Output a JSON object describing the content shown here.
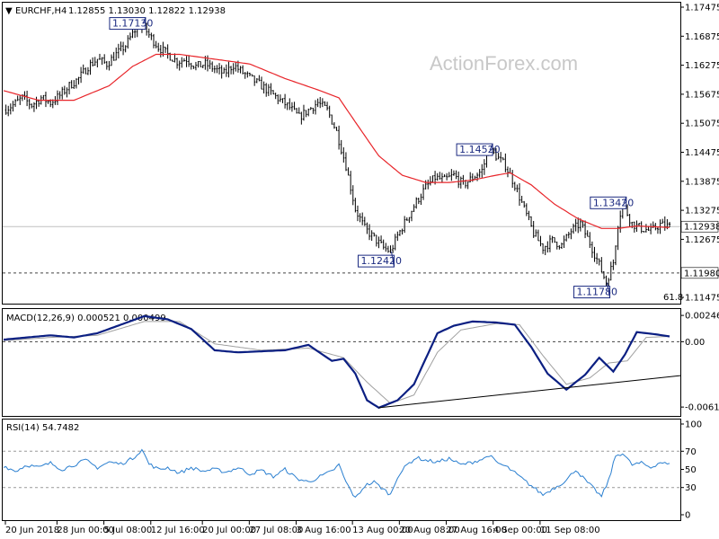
{
  "header": {
    "arrow": "▼",
    "symbol_text": "EURCHF,H4",
    "ohlc_text": "1.12855 1.13030 1.12822 1.12938"
  },
  "watermark": "ActionForex.com",
  "colors": {
    "candle": "#000000",
    "ma": "#e8252a",
    "macd": "#0b1f82",
    "signal": "#a0a0a0",
    "rsi": "#2a7fd0",
    "grid": "#c0c0c0",
    "dashed": "#888888"
  },
  "chart_data": [
    {
      "type": "candlestick",
      "panel": "price",
      "ylim": [
        1.11475,
        1.17475
      ],
      "y_ticks": [
        "1.17475",
        "1.16875",
        "1.16275",
        "1.15675",
        "1.15075",
        "1.14475",
        "1.13875",
        "1.13275",
        "1.12675",
        "1.11980",
        "1.11475"
      ],
      "y_tick_values": [
        1.17475,
        1.16875,
        1.16275,
        1.15675,
        1.15075,
        1.14475,
        1.13875,
        1.13275,
        1.12675,
        1.1198,
        1.11475
      ],
      "current_price_label": "1.12938",
      "current_price": 1.12938,
      "support_label": "1.11980",
      "support": 1.1198,
      "fib_label": "61.8",
      "annotations": [
        {
          "text": "1.17130",
          "value": 1.1713
        },
        {
          "text": "1.12420",
          "value": 1.1242
        },
        {
          "text": "1.14520",
          "value": 1.1452
        },
        {
          "text": "1.11780",
          "value": 1.1178
        },
        {
          "text": "1.13420",
          "value": 1.1342
        }
      ],
      "close_path": [
        [
          0,
          1.1535
        ],
        [
          4,
          1.1545
        ],
        [
          8,
          1.156
        ],
        [
          12,
          1.1545
        ],
        [
          16,
          1.156
        ],
        [
          20,
          1.155
        ],
        [
          24,
          1.1565
        ],
        [
          28,
          1.1585
        ],
        [
          32,
          1.16
        ],
        [
          36,
          1.1625
        ],
        [
          40,
          1.164
        ],
        [
          44,
          1.163
        ],
        [
          48,
          1.165
        ],
        [
          52,
          1.1668
        ],
        [
          56,
          1.17
        ],
        [
          59,
          1.1713
        ],
        [
          62,
          1.169
        ],
        [
          66,
          1.1665
        ],
        [
          70,
          1.165
        ],
        [
          74,
          1.1635
        ],
        [
          78,
          1.164
        ],
        [
          82,
          1.1625
        ],
        [
          86,
          1.163
        ],
        [
          90,
          1.162
        ],
        [
          94,
          1.161
        ],
        [
          98,
          1.1628
        ],
        [
          102,
          1.1612
        ],
        [
          106,
          1.1598
        ],
        [
          110,
          1.1585
        ],
        [
          114,
          1.157
        ],
        [
          118,
          1.1555
        ],
        [
          122,
          1.154
        ],
        [
          126,
          1.152
        ],
        [
          130,
          1.1535
        ],
        [
          134,
          1.155
        ],
        [
          138,
          1.1535
        ],
        [
          142,
          1.149
        ],
        [
          146,
          1.142
        ],
        [
          150,
          1.133
        ],
        [
          154,
          1.129
        ],
        [
          158,
          1.127
        ],
        [
          162,
          1.125
        ],
        [
          165,
          1.1242
        ],
        [
          168,
          1.1275
        ],
        [
          172,
          1.131
        ],
        [
          176,
          1.1345
        ],
        [
          180,
          1.1375
        ],
        [
          184,
          1.1395
        ],
        [
          188,
          1.139
        ],
        [
          192,
          1.14
        ],
        [
          196,
          1.138
        ],
        [
          200,
          1.1395
        ],
        [
          204,
          1.141
        ],
        [
          207,
          1.1452
        ],
        [
          210,
          1.144
        ],
        [
          214,
          1.142
        ],
        [
          218,
          1.138
        ],
        [
          222,
          1.133
        ],
        [
          226,
          1.128
        ],
        [
          230,
          1.125
        ],
        [
          234,
          1.1265
        ],
        [
          238,
          1.1255
        ],
        [
          242,
          1.1285
        ],
        [
          246,
          1.13
        ],
        [
          250,
          1.126
        ],
        [
          254,
          1.1215
        ],
        [
          257,
          1.1178
        ],
        [
          260,
          1.122
        ],
        [
          262,
          1.13
        ],
        [
          264,
          1.1342
        ],
        [
          268,
          1.13
        ],
        [
          272,
          1.129
        ],
        [
          276,
          1.1285
        ],
        [
          280,
          1.1298
        ],
        [
          284,
          1.1294
        ]
      ],
      "ma_path": [
        [
          0,
          1.1575
        ],
        [
          15,
          1.1555
        ],
        [
          30,
          1.1555
        ],
        [
          45,
          1.1585
        ],
        [
          55,
          1.1625
        ],
        [
          65,
          1.165
        ],
        [
          75,
          1.165
        ],
        [
          90,
          1.164
        ],
        [
          105,
          1.163
        ],
        [
          120,
          1.16
        ],
        [
          135,
          1.1575
        ],
        [
          143,
          1.156
        ],
        [
          150,
          1.151
        ],
        [
          160,
          1.144
        ],
        [
          170,
          1.14
        ],
        [
          180,
          1.1385
        ],
        [
          190,
          1.1385
        ],
        [
          200,
          1.139
        ],
        [
          210,
          1.14
        ],
        [
          216,
          1.1405
        ],
        [
          225,
          1.138
        ],
        [
          235,
          1.134
        ],
        [
          245,
          1.131
        ],
        [
          255,
          1.129
        ],
        [
          262,
          1.129
        ],
        [
          270,
          1.1295
        ],
        [
          284,
          1.1292
        ]
      ]
    },
    {
      "type": "line",
      "panel": "macd",
      "title": "MACD(12,26,9) 0.000521 0.000499",
      "ylim": [
        -0.0068,
        0.0029
      ],
      "y_ticks": [
        "0.002469",
        "0.00",
        "-0.006136"
      ],
      "y_tick_values": [
        0.002469,
        0.0,
        -0.006136
      ],
      "series": [
        {
          "values": [
            [
              0,
              0.0002
            ],
            [
              10,
              0.0004
            ],
            [
              20,
              0.0006
            ],
            [
              30,
              0.0004
            ],
            [
              40,
              0.0008
            ],
            [
              50,
              0.0016
            ],
            [
              60,
              0.0024
            ],
            [
              70,
              0.0021
            ],
            [
              80,
              0.0012
            ],
            [
              90,
              -0.0008
            ],
            [
              100,
              -0.001
            ],
            [
              110,
              -0.0009
            ],
            [
              120,
              -0.0008
            ],
            [
              130,
              -0.0003
            ],
            [
              140,
              -0.0018
            ],
            [
              145,
              -0.0016
            ],
            [
              150,
              -0.003
            ],
            [
              155,
              -0.0055
            ],
            [
              160,
              -0.0062
            ],
            [
              168,
              -0.0055
            ],
            [
              175,
              -0.004
            ],
            [
              185,
              0.0008
            ],
            [
              192,
              0.0015
            ],
            [
              200,
              0.0019
            ],
            [
              210,
              0.0018
            ],
            [
              218,
              0.0016
            ],
            [
              225,
              -0.0005
            ],
            [
              232,
              -0.003
            ],
            [
              240,
              -0.0045
            ],
            [
              248,
              -0.0031
            ],
            [
              254,
              -0.0015
            ],
            [
              260,
              -0.0028
            ],
            [
              265,
              -0.0012
            ],
            [
              270,
              0.0009
            ],
            [
              278,
              0.0007
            ],
            [
              284,
              0.0005
            ]
          ]
        },
        {
          "values": [
            [
              0,
              0.0001
            ],
            [
              20,
              0.0004
            ],
            [
              40,
              0.0006
            ],
            [
              60,
              0.0019
            ],
            [
              75,
              0.0019
            ],
            [
              90,
              -0.0002
            ],
            [
              110,
              -0.0008
            ],
            [
              130,
              -0.0006
            ],
            [
              145,
              -0.0015
            ],
            [
              155,
              -0.0038
            ],
            [
              165,
              -0.0058
            ],
            [
              175,
              -0.005
            ],
            [
              185,
              -0.001
            ],
            [
              195,
              0.0011
            ],
            [
              210,
              0.0017
            ],
            [
              220,
              0.0016
            ],
            [
              230,
              -0.0013
            ],
            [
              240,
              -0.004
            ],
            [
              250,
              -0.0034
            ],
            [
              258,
              -0.002
            ],
            [
              266,
              -0.0018
            ],
            [
              274,
              0.0004
            ],
            [
              284,
              0.0005
            ]
          ]
        }
      ],
      "trendline": [
        [
          160,
          -0.0062
        ],
        [
          284,
          -0.0033
        ]
      ]
    },
    {
      "type": "line",
      "panel": "rsi",
      "title": "RSI(14) 54.7482",
      "ylim": [
        0,
        100
      ],
      "y_ticks": [
        "100",
        "70",
        "50",
        "30",
        "0"
      ],
      "y_tick_values": [
        100,
        70,
        50,
        30,
        0
      ],
      "levels": [
        70,
        30
      ],
      "series": [
        {
          "values": [
            [
              0,
              54
            ],
            [
              5,
              48
            ],
            [
              10,
              55
            ],
            [
              15,
              52
            ],
            [
              20,
              57
            ],
            [
              25,
              50
            ],
            [
              30,
              55
            ],
            [
              35,
              60
            ],
            [
              40,
              52
            ],
            [
              45,
              58
            ],
            [
              50,
              56
            ],
            [
              55,
              62
            ],
            [
              59,
              72
            ],
            [
              62,
              56
            ],
            [
              66,
              50
            ],
            [
              70,
              52
            ],
            [
              75,
              46
            ],
            [
              80,
              52
            ],
            [
              85,
              48
            ],
            [
              90,
              50
            ],
            [
              95,
              47
            ],
            [
              100,
              52
            ],
            [
              105,
              45
            ],
            [
              110,
              49
            ],
            [
              115,
              42
            ],
            [
              120,
              50
            ],
            [
              125,
              40
            ],
            [
              130,
              36
            ],
            [
              135,
              42
            ],
            [
              140,
              48
            ],
            [
              143,
              55
            ],
            [
              146,
              36
            ],
            [
              150,
              18
            ],
            [
              154,
              32
            ],
            [
              158,
              36
            ],
            [
              162,
              28
            ],
            [
              165,
              22
            ],
            [
              168,
              42
            ],
            [
              172,
              55
            ],
            [
              176,
              63
            ],
            [
              180,
              60
            ],
            [
              185,
              58
            ],
            [
              190,
              62
            ],
            [
              195,
              55
            ],
            [
              200,
              58
            ],
            [
              205,
              62
            ],
            [
              207,
              66
            ],
            [
              210,
              58
            ],
            [
              215,
              52
            ],
            [
              220,
              42
            ],
            [
              225,
              32
            ],
            [
              230,
              22
            ],
            [
              235,
              30
            ],
            [
              240,
              38
            ],
            [
              244,
              50
            ],
            [
              248,
              38
            ],
            [
              252,
              28
            ],
            [
              255,
              20
            ],
            [
              258,
              38
            ],
            [
              261,
              65
            ],
            [
              264,
              68
            ],
            [
              268,
              55
            ],
            [
              272,
              57
            ],
            [
              276,
              52
            ],
            [
              280,
              58
            ],
            [
              284,
              55
            ]
          ]
        }
      ]
    }
  ],
  "x_axis": {
    "labels": [
      {
        "text": "20 Jun 2018",
        "bar": 0
      },
      {
        "text": "28 Jun 00:00",
        "bar": 22
      },
      {
        "text": "5 Jul 08:00",
        "bar": 42
      },
      {
        "text": "12 Jul 16:00",
        "bar": 62
      },
      {
        "text": "20 Jul 00:00",
        "bar": 84
      },
      {
        "text": "27 Jul 08:00",
        "bar": 104
      },
      {
        "text": "3 Aug 16:00",
        "bar": 124
      },
      {
        "text": "13 Aug 00:00",
        "bar": 148
      },
      {
        "text": "20 Aug 08:00",
        "bar": 168
      },
      {
        "text": "27 Aug 16:00",
        "bar": 188
      },
      {
        "text": "4 Sep 00:00",
        "bar": 208
      },
      {
        "text": "11 Sep 08:00",
        "bar": 228
      }
    ],
    "n_bars": 285
  }
}
